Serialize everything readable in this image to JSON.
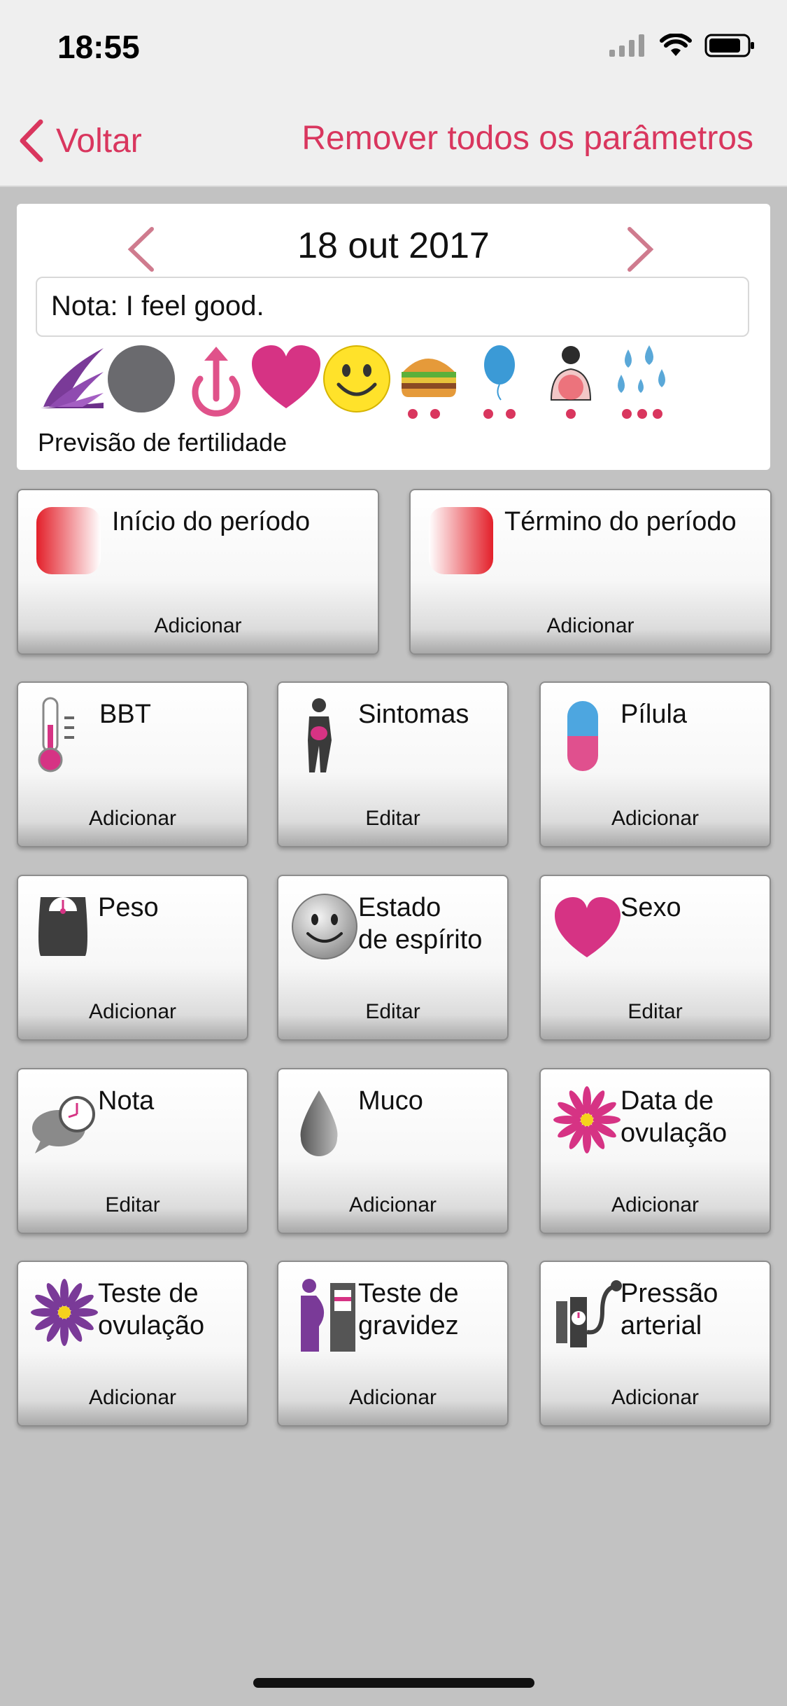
{
  "status": {
    "time": "18:55"
  },
  "nav": {
    "back_label": "Voltar",
    "remove_all_label": "Remover todos os parâmetros"
  },
  "day": {
    "date": "18 out 2017",
    "note": "Nota: I feel good.",
    "forecast_label": "Previsão de fertilidade",
    "strip_icons": [
      "fertility-flower-icon",
      "circle-icon",
      "power-arrow-icon",
      "heart-icon",
      "smiley-icon",
      "burger-icon",
      "balloon-icon",
      "breast-pain-icon",
      "drops-icon"
    ]
  },
  "tiles": {
    "period_start": {
      "label": "Início do período",
      "action": "Adicionar"
    },
    "period_end": {
      "label": "Término do período",
      "action": "Adicionar"
    },
    "bbt": {
      "label": "BBT",
      "action": "Adicionar"
    },
    "symptoms": {
      "label": "Sintomas",
      "action": "Editar"
    },
    "pill": {
      "label": "Pílula",
      "action": "Adicionar"
    },
    "weight": {
      "label": "Peso",
      "action": "Adicionar"
    },
    "mood": {
      "label": "Estado\nde espírito",
      "action": "Editar"
    },
    "sex": {
      "label": "Sexo",
      "action": "Editar"
    },
    "note": {
      "label": "Nota",
      "action": "Editar"
    },
    "mucus": {
      "label": "Muco",
      "action": "Adicionar"
    },
    "ovulation_date": {
      "label": "Data de\novulação",
      "action": "Adicionar"
    },
    "ovulation_test": {
      "label": "Teste de\novulação",
      "action": "Adicionar"
    },
    "pregnancy_test": {
      "label": "Teste de\ngravidez",
      "action": "Adicionar"
    },
    "blood_pressure": {
      "label": "Pressão\narterial",
      "action": "Adicionar"
    }
  },
  "colors": {
    "accent": "#d9365e",
    "magenta": "#d63384",
    "purple": "#7a3a98"
  }
}
